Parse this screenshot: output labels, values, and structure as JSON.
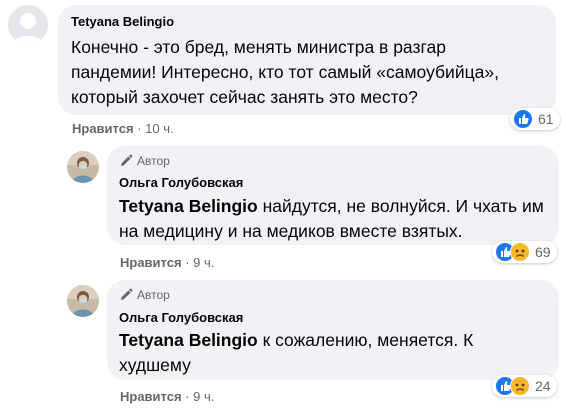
{
  "comments": [
    {
      "author": "Tetyana Belingio",
      "text": "Конечно - это бред, менять министра в разгар пандемии! Интересно, кто тот самый «самоубийца», который захочет сейчас занять это место?",
      "reaction_count": "61",
      "reactions": [
        "like-icon"
      ],
      "like_label": "Нравится",
      "separator": "·",
      "time": "10 ч."
    }
  ],
  "replies": [
    {
      "badge": "Автор",
      "author": "Ольга Голубовская",
      "mention": "Tetyana Belingio",
      "text": " найдутся, не волнуйся. И чхать им на медицину и на медиков вместе взятых.",
      "reaction_count": "69",
      "reactions": [
        "like-icon",
        "sad-icon"
      ],
      "like_label": "Нравится",
      "separator": "·",
      "time": "9 ч."
    },
    {
      "badge": "Автор",
      "author": "Ольга Голубовская",
      "mention": "Tetyana Belingio",
      "text": " к сожалению, меняется. К худшему",
      "reaction_count": "24",
      "reactions": [
        "like-icon",
        "sad-icon"
      ],
      "like_label": "Нравится",
      "separator": "·",
      "time": "9 ч."
    }
  ],
  "colors": {
    "bubble": "#f0f2f5",
    "like": "#1877f2",
    "sad": "#f7b928",
    "meta": "#65676b"
  }
}
